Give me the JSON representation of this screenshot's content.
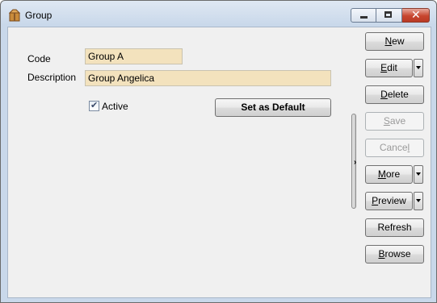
{
  "window": {
    "title": "Group"
  },
  "form": {
    "code_label": "Code",
    "code_value": "Group A",
    "description_label": "Description",
    "description_value": "Group Angelica",
    "active_label": "Active",
    "active_checked": true,
    "set_default_label": "Set as Default"
  },
  "buttons": {
    "new": {
      "pre": "",
      "mn": "N",
      "post": "ew"
    },
    "edit": {
      "pre": "",
      "mn": "E",
      "post": "dit"
    },
    "delete": {
      "pre": "",
      "mn": "D",
      "post": "elete"
    },
    "save": {
      "pre": "",
      "mn": "S",
      "post": "ave"
    },
    "cancel": {
      "pre": "Cance",
      "mn": "l",
      "post": ""
    },
    "more": {
      "pre": "",
      "mn": "M",
      "post": "ore"
    },
    "preview": {
      "pre": "",
      "mn": "P",
      "post": "review"
    },
    "refresh": {
      "pre": "Refresh",
      "mn": "",
      "post": ""
    },
    "browse": {
      "pre": "",
      "mn": "B",
      "post": "rowse"
    }
  },
  "icons": {
    "app": "package-icon",
    "minimize": "minimize-icon",
    "maximize": "maximize-icon",
    "close": "close-icon",
    "splitter": "chevron-right-icon",
    "dropdown": "chevron-down-icon"
  }
}
